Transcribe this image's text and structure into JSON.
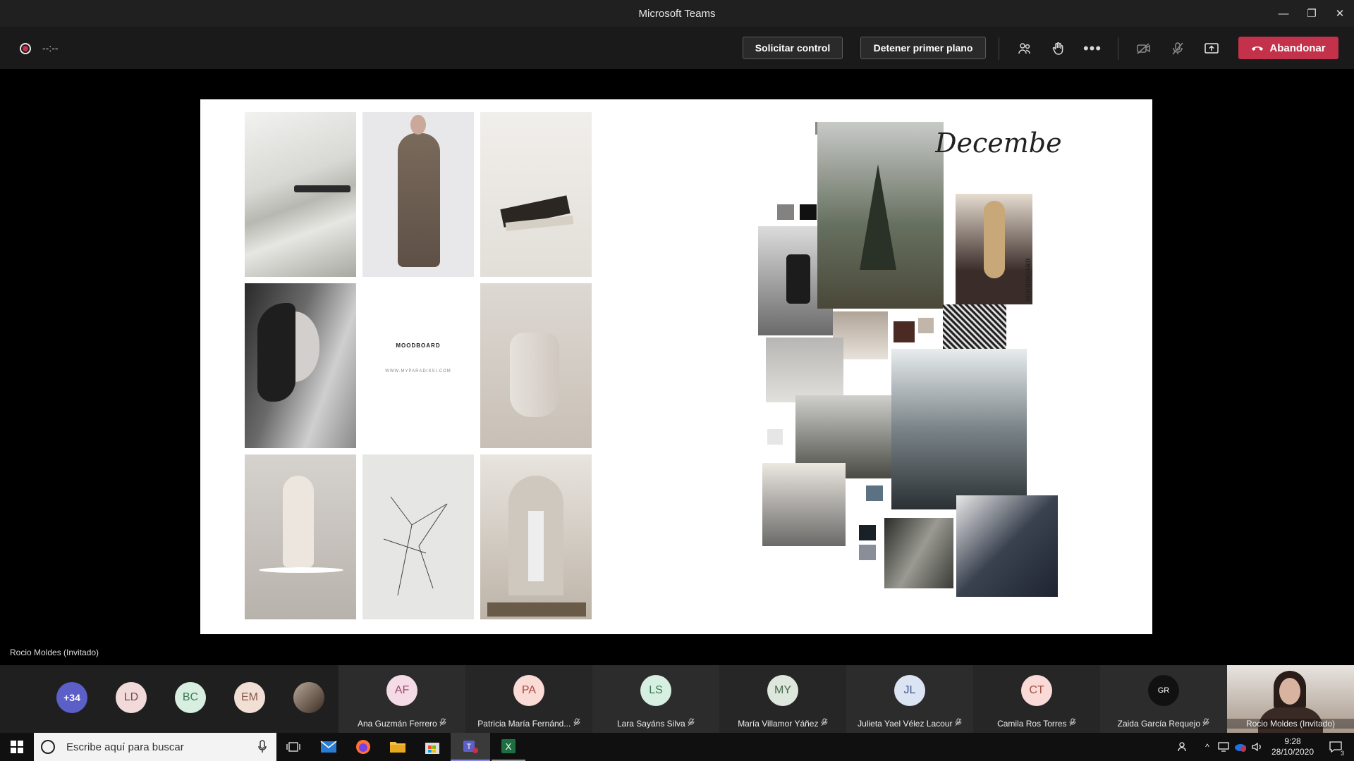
{
  "window": {
    "title": "Microsoft Teams"
  },
  "toolbar": {
    "timer": "--:--",
    "request_control": "Solicitar control",
    "stop_spotlight": "Detener primer plano",
    "leave": "Abandonar"
  },
  "slide": {
    "left_caption_title": "MOODBOARD",
    "left_caption_url": "WWW.MYPARADISSI.COM",
    "right_script": "December",
    "right_vertical": "MOODBOARD"
  },
  "presenter_label": "Rocio Moldes (Invitado)",
  "participants": {
    "overflow": "+34",
    "small": [
      {
        "initials": "LD",
        "color": "#f2dada"
      },
      {
        "initials": "BC",
        "color": "#d7eee0"
      },
      {
        "initials": "EM",
        "color": "#f1dfd6"
      }
    ],
    "tiles": [
      {
        "initials": "AF",
        "name": "Ana Guzmán Ferrero",
        "color": "#f5dbe6",
        "text": "#9a4a6a"
      },
      {
        "initials": "PA",
        "name": "Patricia María Fernánd...",
        "color": "#fbdbd6",
        "text": "#a8473a"
      },
      {
        "initials": "LS",
        "name": "Lara Sayáns Silva",
        "color": "#d6efe0",
        "text": "#3a7a55"
      },
      {
        "initials": "MY",
        "name": "María Villamor Yáñez",
        "color": "#dde7dc",
        "text": "#4a6a50"
      },
      {
        "initials": "JL",
        "name": "Julieta Yael Vélez Lacour",
        "color": "#dbe4f3",
        "text": "#41588c"
      },
      {
        "initials": "CT",
        "name": "Camila Ros Torres",
        "color": "#fadad6",
        "text": "#a34a3e"
      },
      {
        "initials": "GR",
        "name": "Zaida García Requejo",
        "color": "#111111",
        "text": "#ffffff"
      }
    ],
    "self_name": "Rocio Moldes (Invitado)"
  },
  "taskbar": {
    "search_placeholder": "Escribe aquí para buscar",
    "time": "9:28",
    "date": "28/10/2020",
    "notifications": "3"
  }
}
